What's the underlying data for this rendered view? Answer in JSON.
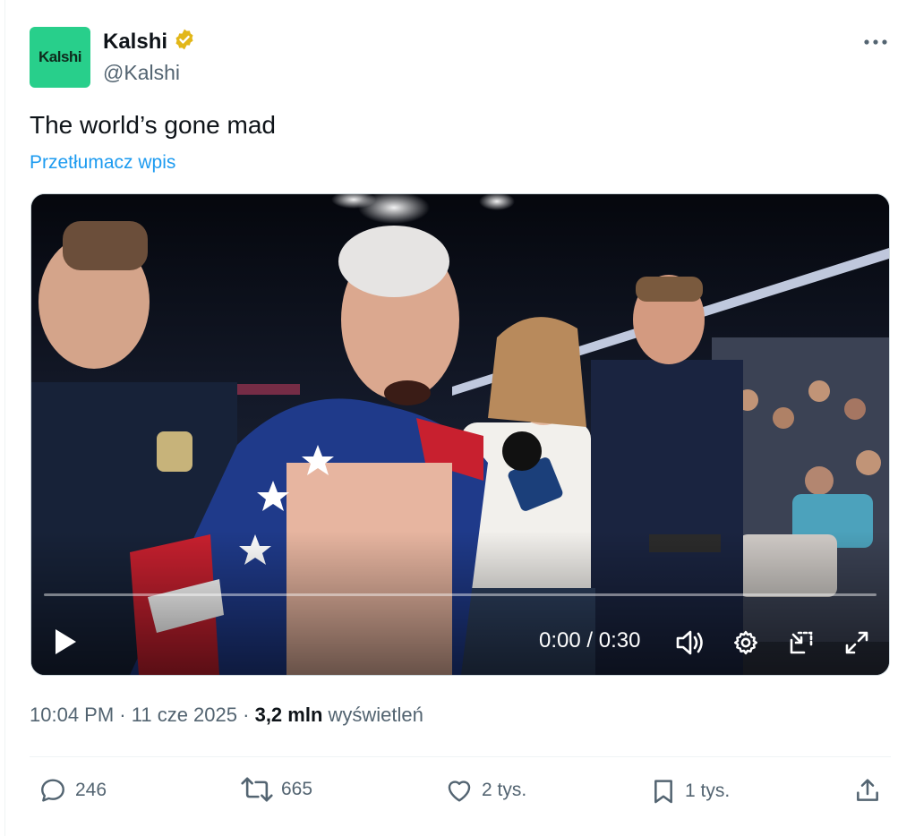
{
  "author": {
    "avatar_text": "Kalshi",
    "display_name": "Kalshi",
    "handle": "@Kalshi",
    "verified_badge_color": "#e2b719",
    "avatar_color": "#28cf8b"
  },
  "tweet": {
    "text": "The world’s gone mad",
    "translate_label": "Przetłumacz wpis"
  },
  "video": {
    "time_display": "0:00 / 0:30",
    "progress": 0,
    "controls": [
      "play-icon",
      "volume-icon",
      "settings-icon",
      "pip-icon",
      "fullscreen-icon"
    ]
  },
  "meta": {
    "time": "10:04 PM",
    "date": "11 cze 2025",
    "views_count": "3,2 mln",
    "views_label": "wyświetleń",
    "separator": "·"
  },
  "actions": {
    "replies": "246",
    "reposts": "665",
    "likes": "2 tys.",
    "bookmarks": "1 tys."
  },
  "colors": {
    "accent": "#1d9bf0",
    "secondary_text": "#536471"
  }
}
